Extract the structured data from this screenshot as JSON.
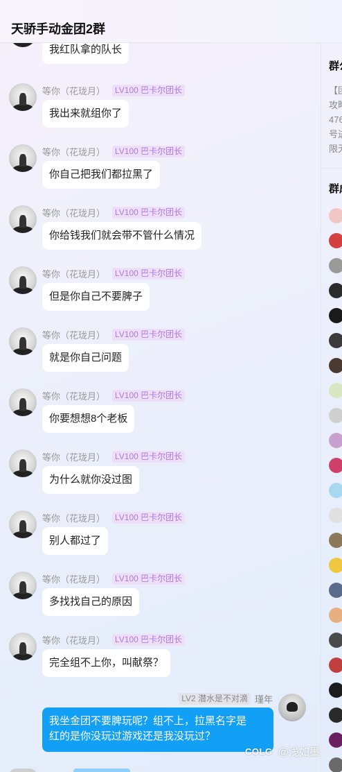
{
  "header": {
    "title": "天骄手动金团2群"
  },
  "chat": {
    "partial_top": {
      "text": "我红队拿的队长"
    },
    "messages": [
      {
        "user": "等你（花珑月）",
        "badge": "LV100 巴卡尔团长",
        "text": "我出来就组你了"
      },
      {
        "user": "等你（花珑月）",
        "badge": "LV100 巴卡尔团长",
        "text": "你自己把我们都拉黑了"
      },
      {
        "user": "等你（花珑月）",
        "badge": "LV100 巴卡尔团长",
        "text": "你给钱我们就会带不管什么情况"
      },
      {
        "user": "等你（花珑月）",
        "badge": "LV100 巴卡尔团长",
        "text": "但是你自己不要脾子"
      },
      {
        "user": "等你（花珑月）",
        "badge": "LV100 巴卡尔团长",
        "text": "就是你自己问题"
      },
      {
        "user": "等你（花珑月）",
        "badge": "LV100 巴卡尔团长",
        "text": "你要想想8个老板"
      },
      {
        "user": "等你（花珑月）",
        "badge": "LV100 巴卡尔团长",
        "text": "为什么就你没过图"
      },
      {
        "user": "等你（花珑月）",
        "badge": "LV100 巴卡尔团长",
        "text": "别人都过了"
      },
      {
        "user": "等你（花珑月）",
        "badge": "LV100 巴卡尔团长",
        "text": "多找找自己的原因"
      },
      {
        "user": "等你（花珑月）",
        "badge": "LV100 巴卡尔团长",
        "text": "完全组不上你，叫献祭？"
      }
    ],
    "mine": {
      "badge": "LV2 潜水是不对滴",
      "user": "瑾年",
      "line1": "我坐金团不要脾玩呢？组不上，拉黑名字是",
      "line2": "红的是你没玩过游戏还是我没玩过？"
    },
    "watermark": {
      "logo": "COLG",
      "name": "@浅如墨"
    }
  },
  "side": {
    "title": "群公",
    "notice_lines": [
      "【团",
      "攻略",
      "476",
      "号进",
      "限无"
    ],
    "members_title": "群成",
    "member_colors": [
      "#f3c6c6",
      "#d43f3f",
      "#9a9a9a",
      "#2b2b2b",
      "#1a1a1a",
      "#3a3a3a",
      "#4a3a30",
      "#d9e6c0",
      "#cfcfcf",
      "#c8a0d0",
      "#d0406a",
      "#a8d8f0",
      "#e0e0e0",
      "#8a7a5a",
      "#f0c840",
      "#5a6a8a",
      "#e8b080",
      "#4a4a4a",
      "#c04040",
      "#1c1c1c",
      "#2a2a2a",
      "#6a2060",
      "#6a6a6a"
    ]
  }
}
